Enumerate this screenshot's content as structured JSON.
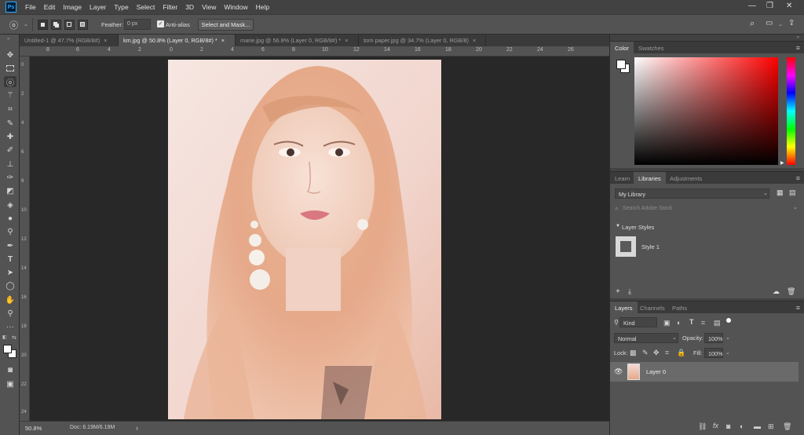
{
  "app": {
    "logo": "Ps",
    "colors": {
      "accent": "#31a8ff",
      "chrome": "#535353",
      "dark": "#282828"
    }
  },
  "menu": [
    "File",
    "Edit",
    "Image",
    "Layer",
    "Type",
    "Select",
    "Filter",
    "3D",
    "View",
    "Window",
    "Help"
  ],
  "options": {
    "tool_icon": "lasso-icon",
    "feather_label": "Feather:",
    "feather_value": "0 px",
    "antialias_label": "Anti-alias",
    "antialias_checked": true,
    "select_mask_label": "Select and Mask..."
  },
  "tabs": [
    {
      "label": "Untitled-1 @ 47.7% (RGB/8#)",
      "close": "×",
      "active": false
    },
    {
      "label": "km.jpg @ 50.8% (Layer 0, RGB/8#) *",
      "close": "×",
      "active": true
    },
    {
      "label": "marie.jpg @ 56.8% (Layer 0, RGB/8#) *",
      "close": "×",
      "active": false
    },
    {
      "label": "torn paper.jpg @ 34.7% (Layer 0, RGB/8)",
      "close": "×",
      "active": false
    }
  ],
  "ruler_top_labels": [
    "8",
    "6",
    "4",
    "2",
    "0",
    "2",
    "4",
    "6",
    "8",
    "10",
    "12",
    "14",
    "16",
    "18",
    "20",
    "22",
    "24",
    "26"
  ],
  "ruler_left_labels": [
    "0",
    "2",
    "4",
    "6",
    "8",
    "10",
    "12",
    "14",
    "16",
    "18",
    "20",
    "22",
    "24"
  ],
  "status": {
    "zoom": "50.8%",
    "doc": "Doc: 6.19M/6.19M",
    "arrow": "›"
  },
  "color_panel": {
    "tabs": [
      "Color",
      "Swatches"
    ],
    "active": 0,
    "hue": "#ff0000"
  },
  "libraries_panel": {
    "tabs": [
      "Learn",
      "Libraries",
      "Adjustments"
    ],
    "active": 1,
    "library_name": "My Library",
    "search_placeholder": "Search Adobe Stock",
    "section": "Layer Styles",
    "item": "Style 1"
  },
  "layers_panel": {
    "tabs": [
      "Layers",
      "Channels",
      "Paths"
    ],
    "active": 0,
    "filter_kind": "Kind",
    "blend_mode": "Normal",
    "opacity_label": "Opacity:",
    "opacity_value": "100%",
    "lock_label": "Lock:",
    "fill_label": "Fill:",
    "fill_value": "100%",
    "layers": [
      {
        "name": "Layer 0",
        "visible": true,
        "selected": true
      }
    ]
  }
}
